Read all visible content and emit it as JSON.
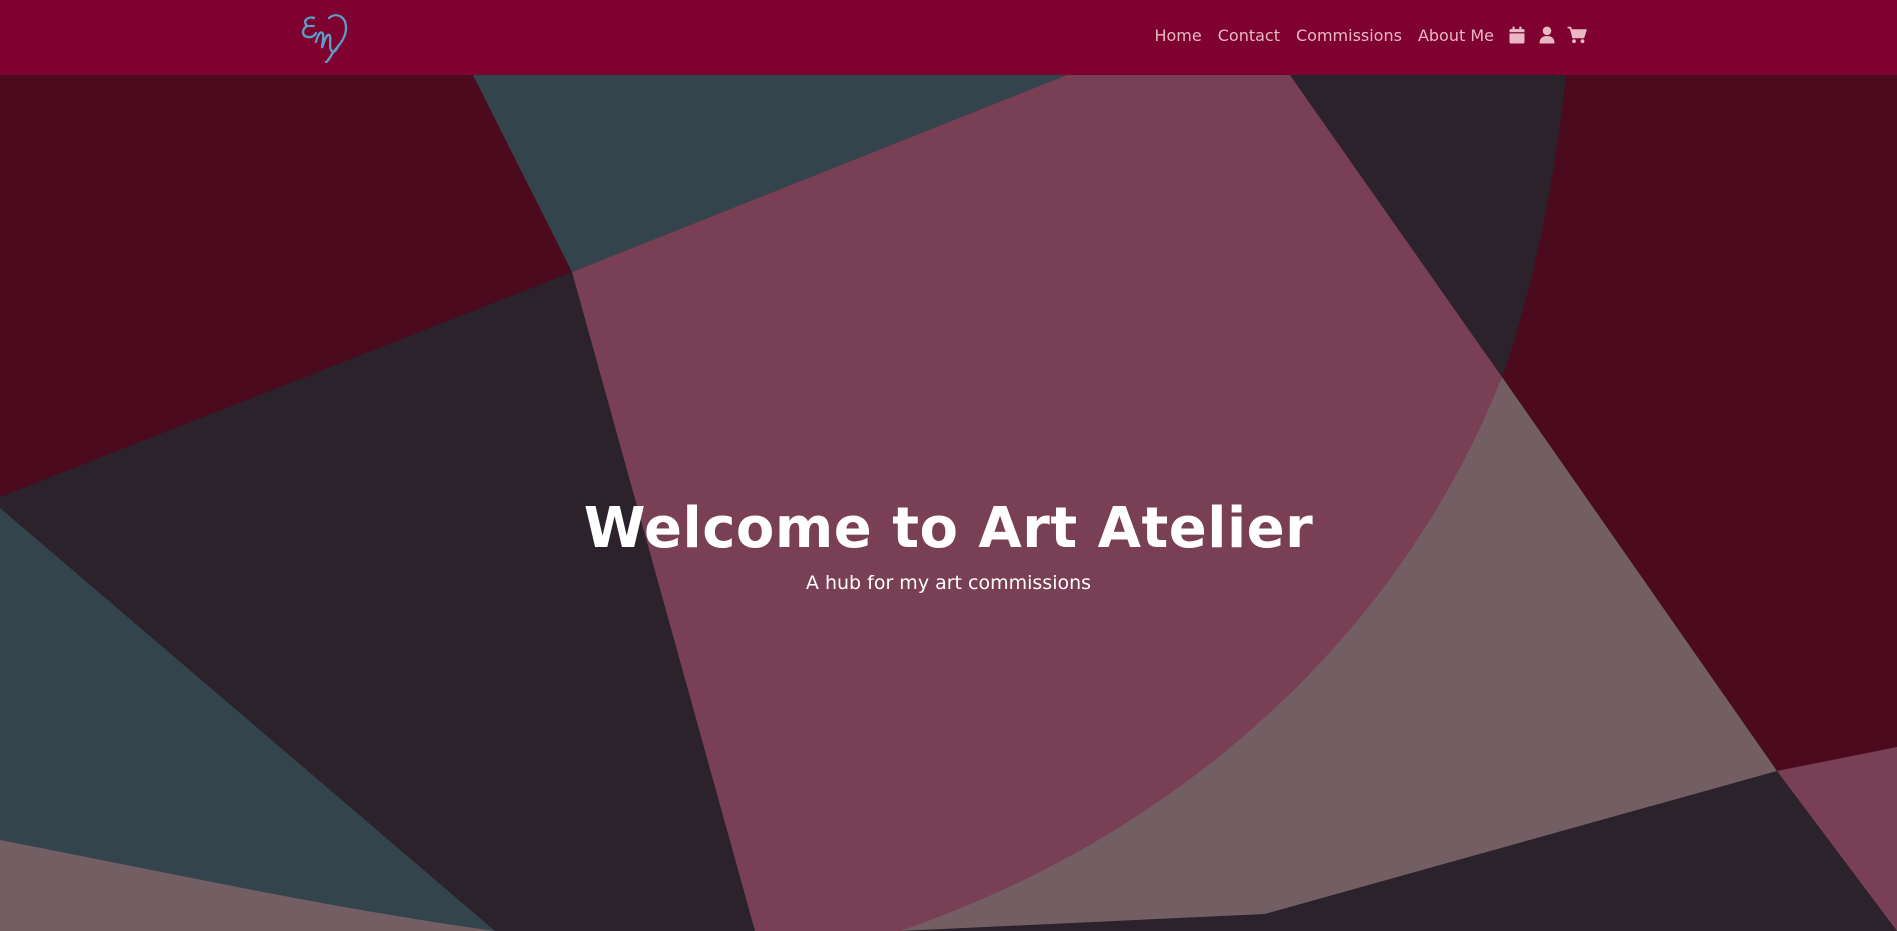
{
  "navbar": {
    "logo_text": "EM",
    "links": [
      {
        "label": "Home"
      },
      {
        "label": "Contact"
      },
      {
        "label": "Commissions"
      },
      {
        "label": "About Me"
      }
    ],
    "icons": [
      "calendar-icon",
      "user-icon",
      "shopping-cart-icon"
    ]
  },
  "hero": {
    "title": "Welcome to Art Atelier",
    "subtitle": "A hub for my art commissions"
  },
  "colors": {
    "navbar": "#7f0130",
    "nav_text": "#e9b8c4",
    "logo": "#5a9fc8",
    "hero_text": "#ffffff",
    "shape_dark_red": "#4b0a1e",
    "shape_slate": "#34444c",
    "shape_mauve": "#793f55",
    "shape_dark": "#2b222b",
    "shape_taupe": "#735f63"
  }
}
